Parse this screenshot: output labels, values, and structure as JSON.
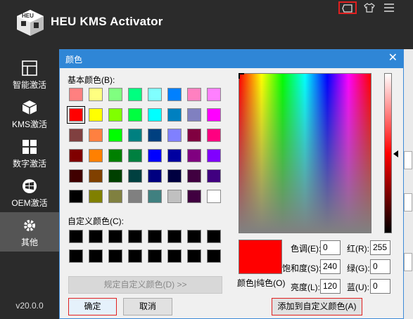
{
  "app": {
    "title": "HEU KMS Activator",
    "version": "v20.0.0"
  },
  "titlebar_buttons": [
    {
      "name": "skin-icon-button",
      "glyph": "▭",
      "highlighted": true
    },
    {
      "name": "shirt-icon-button",
      "glyph": "👕",
      "highlighted": false
    },
    {
      "name": "menu-icon-button",
      "glyph": "☰",
      "highlighted": false
    }
  ],
  "sidebar": {
    "items": [
      {
        "label": "智能激活",
        "icon": "windows-icon"
      },
      {
        "label": "KMS激活",
        "icon": "cube-icon"
      },
      {
        "label": "数字激活",
        "icon": "windows-grid-icon"
      },
      {
        "label": "OEM激活",
        "icon": "windows-logo-icon"
      },
      {
        "label": "其他",
        "icon": "gear-icon",
        "active": true
      }
    ]
  },
  "dialog": {
    "title": "颜色",
    "basic_colors_label": "基本颜色(B):",
    "custom_colors_label": "自定义颜色(C):",
    "define_custom_button": "规定自定义颜色(D) >>",
    "ok_button": "确定",
    "cancel_button": "取消",
    "add_custom_button": "添加到自定义颜色(A)",
    "color_solid_label": "颜色|纯色(O)",
    "fields": {
      "hue": {
        "label": "色调(E):",
        "value": "0"
      },
      "sat": {
        "label": "饱和度(S):",
        "value": "240"
      },
      "lum": {
        "label": "亮度(L):",
        "value": "120"
      },
      "red": {
        "label": "红(R):",
        "value": "255"
      },
      "green": {
        "label": "绿(G):",
        "value": "0"
      },
      "blue": {
        "label": "蓝(U):",
        "value": "0"
      }
    },
    "basic_colors": [
      [
        "#ff8080",
        "#ffff80",
        "#80ff80",
        "#00ff80",
        "#80ffff",
        "#0080ff",
        "#ff80c0",
        "#ff80ff"
      ],
      [
        "#ff0000",
        "#ffff00",
        "#80ff00",
        "#00ff40",
        "#00ffff",
        "#0080c0",
        "#8080c0",
        "#ff00ff"
      ],
      [
        "#804040",
        "#ff8040",
        "#00ff00",
        "#008080",
        "#004080",
        "#8080ff",
        "#800040",
        "#ff0080"
      ],
      [
        "#800000",
        "#ff8000",
        "#008000",
        "#008040",
        "#0000ff",
        "#0000a0",
        "#800080",
        "#8000ff"
      ],
      [
        "#400000",
        "#804000",
        "#004000",
        "#004040",
        "#000080",
        "#000040",
        "#400040",
        "#400080"
      ],
      [
        "#000000",
        "#808000",
        "#808040",
        "#808080",
        "#408080",
        "#c0c0c0",
        "#400040",
        "#ffffff"
      ]
    ],
    "selected_color": "#ff0000",
    "custom_colors_count_note": ""
  }
}
